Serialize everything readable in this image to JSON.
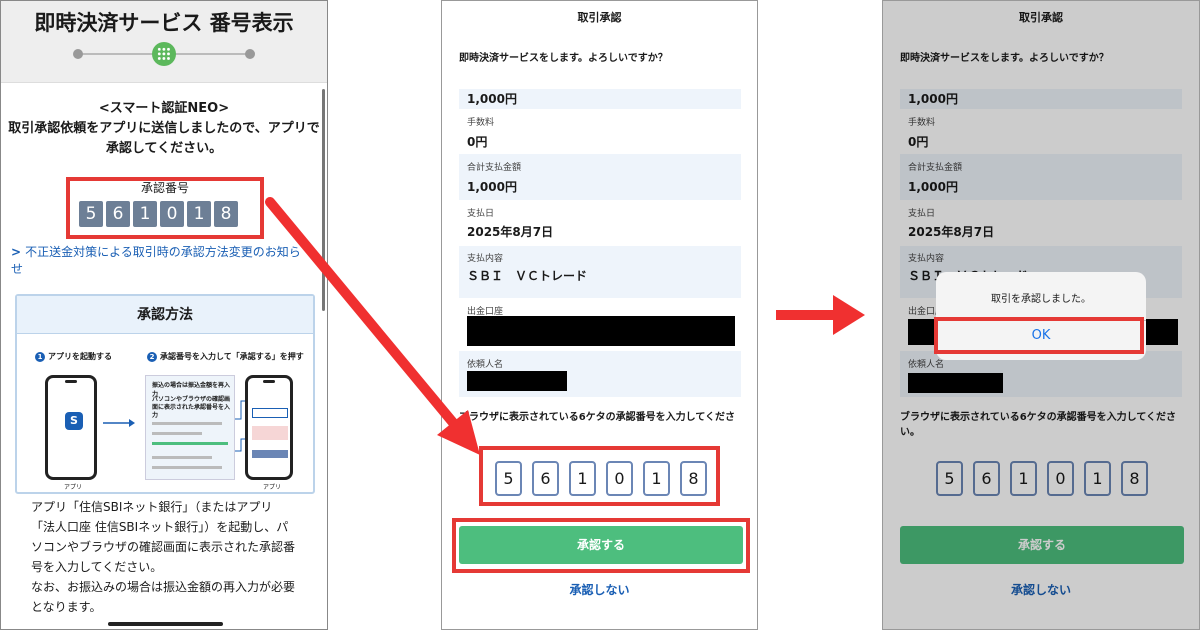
{
  "panel1": {
    "title": "即時決済サービス 番号表示",
    "heading_lines": [
      "<スマート認証NEO>",
      "取引承認依頼をアプリに送信しましたので、アプリで",
      "承認してください。"
    ],
    "code_label": "承認番号",
    "code_digits": [
      "5",
      "6",
      "1",
      "0",
      "1",
      "8"
    ],
    "notice_link": "不正送金対策による取引時の承認方法変更のお知らせ",
    "method_title": "承認方法",
    "step1": "アプリを起動する",
    "step2": "承認番号を入力して「承認する」を押す",
    "step1_num": "1",
    "step2_num": "2",
    "phone_caption_app": "アプリ",
    "mock_line1": "振込の場合は振込金額を再入力",
    "mock_line2": "パソコンやブラウザの確認画面に表示された承認番号を入力",
    "body_lines": [
      "アプリ「住信SBIネット銀行」（またはアプリ",
      "「法人口座 住信SBIネット銀行」）を起動し、パ",
      "ソコンやブラウザの確認画面に表示された承認番",
      "号を入力してください。",
      "なお、お振込みの場合は振込金額の再入力が必要",
      "となります。"
    ]
  },
  "confirm": {
    "title": "取引承認",
    "prompt": "即時決済サービスをします。よろしいですか？",
    "amount": "1,000円",
    "fee_label": "手数料",
    "fee": "0円",
    "total_label": "合計支払金額",
    "total": "1,000円",
    "date_label": "支払日",
    "date": "2025年8月7日",
    "content_label": "支払内容",
    "content": "ＳＢＩ　ＶＣトレード",
    "account_label": "出金口座",
    "requester_label": "依頼人名",
    "instruction": "ブラウザに表示されている6ケタの承認番号を入力してください。",
    "digits": [
      "5",
      "6",
      "1",
      "0",
      "1",
      "8"
    ],
    "approve_button": "承認する",
    "reject_link": "承認しない"
  },
  "dialog": {
    "message": "取引を承認しました。",
    "ok": "OK"
  },
  "colors": {
    "highlight": "#e53935",
    "approve": "#4dbe7e",
    "link": "#1a5fb4",
    "code_bg": "#6d7f96"
  }
}
